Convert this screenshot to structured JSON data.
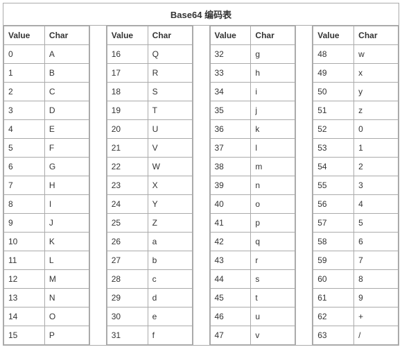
{
  "title": "Base64 编码表",
  "headers": {
    "value": "Value",
    "char": "Char"
  },
  "groups": [
    [
      {
        "value": "0",
        "char": "A"
      },
      {
        "value": "1",
        "char": "B"
      },
      {
        "value": "2",
        "char": "C"
      },
      {
        "value": "3",
        "char": "D"
      },
      {
        "value": "4",
        "char": "E"
      },
      {
        "value": "5",
        "char": "F"
      },
      {
        "value": "6",
        "char": "G"
      },
      {
        "value": "7",
        "char": "H"
      },
      {
        "value": "8",
        "char": "I"
      },
      {
        "value": "9",
        "char": "J"
      },
      {
        "value": "10",
        "char": "K"
      },
      {
        "value": "11",
        "char": "L"
      },
      {
        "value": "12",
        "char": "M"
      },
      {
        "value": "13",
        "char": "N"
      },
      {
        "value": "14",
        "char": "O"
      },
      {
        "value": "15",
        "char": "P"
      }
    ],
    [
      {
        "value": "16",
        "char": "Q"
      },
      {
        "value": "17",
        "char": "R"
      },
      {
        "value": "18",
        "char": "S"
      },
      {
        "value": "19",
        "char": "T"
      },
      {
        "value": "20",
        "char": "U"
      },
      {
        "value": "21",
        "char": "V"
      },
      {
        "value": "22",
        "char": "W"
      },
      {
        "value": "23",
        "char": "X"
      },
      {
        "value": "24",
        "char": "Y"
      },
      {
        "value": "25",
        "char": "Z"
      },
      {
        "value": "26",
        "char": "a"
      },
      {
        "value": "27",
        "char": "b"
      },
      {
        "value": "28",
        "char": "c"
      },
      {
        "value": "29",
        "char": "d"
      },
      {
        "value": "30",
        "char": "e"
      },
      {
        "value": "31",
        "char": "f"
      }
    ],
    [
      {
        "value": "32",
        "char": "g"
      },
      {
        "value": "33",
        "char": "h"
      },
      {
        "value": "34",
        "char": "i"
      },
      {
        "value": "35",
        "char": "j"
      },
      {
        "value": "36",
        "char": "k"
      },
      {
        "value": "37",
        "char": "l"
      },
      {
        "value": "38",
        "char": "m"
      },
      {
        "value": "39",
        "char": "n"
      },
      {
        "value": "40",
        "char": "o"
      },
      {
        "value": "41",
        "char": "p"
      },
      {
        "value": "42",
        "char": "q"
      },
      {
        "value": "43",
        "char": "r"
      },
      {
        "value": "44",
        "char": "s"
      },
      {
        "value": "45",
        "char": "t"
      },
      {
        "value": "46",
        "char": "u"
      },
      {
        "value": "47",
        "char": "v"
      }
    ],
    [
      {
        "value": "48",
        "char": "w"
      },
      {
        "value": "49",
        "char": "x"
      },
      {
        "value": "50",
        "char": "y"
      },
      {
        "value": "51",
        "char": "z"
      },
      {
        "value": "52",
        "char": "0"
      },
      {
        "value": "53",
        "char": "1"
      },
      {
        "value": "54",
        "char": "2"
      },
      {
        "value": "55",
        "char": "3"
      },
      {
        "value": "56",
        "char": "4"
      },
      {
        "value": "57",
        "char": "5"
      },
      {
        "value": "58",
        "char": "6"
      },
      {
        "value": "59",
        "char": "7"
      },
      {
        "value": "60",
        "char": "8"
      },
      {
        "value": "61",
        "char": "9"
      },
      {
        "value": "62",
        "char": "+"
      },
      {
        "value": "63",
        "char": "/"
      }
    ]
  ]
}
